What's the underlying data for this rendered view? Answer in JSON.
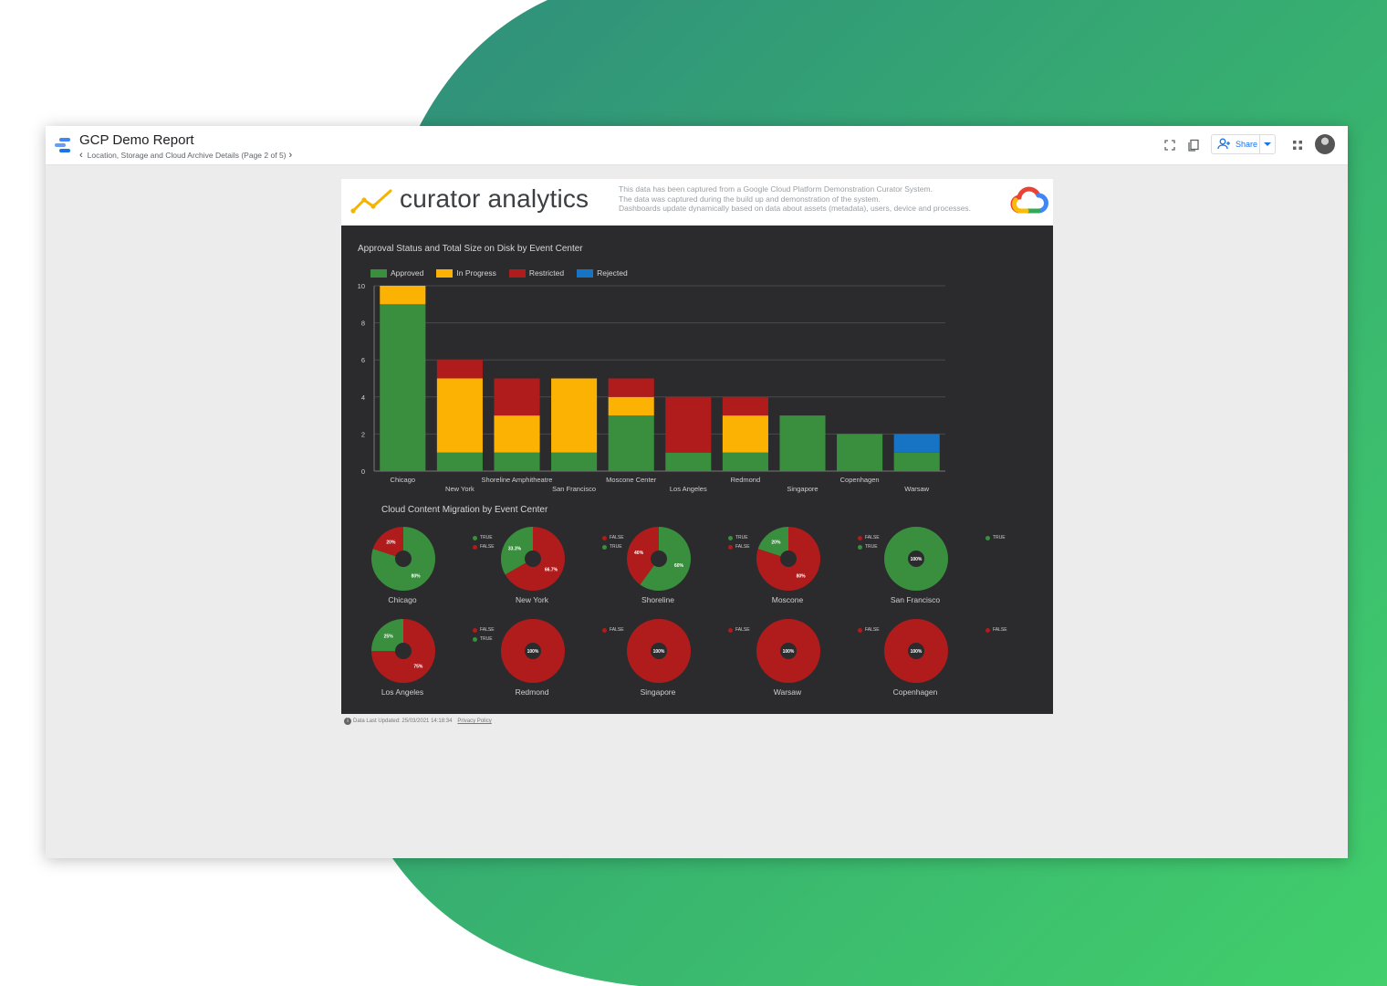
{
  "app": {
    "report_title": "GCP Demo Report",
    "page_label": "Location, Storage and Cloud Archive Details (Page 2 of 5)",
    "share_label": "Share"
  },
  "icons": {
    "prev_page": "chevron-left-icon",
    "next_page": "chevron-right-icon",
    "fullscreen": "fullscreen-icon",
    "copy": "copy-icon",
    "add_person": "add-person-icon",
    "dropdown": "chevron-down-icon",
    "apps": "apps-grid-icon",
    "avatar": "user-avatar"
  },
  "header": {
    "brand": "curator analytics",
    "desc_line1": "This data has been captured from a Google Cloud Platform Demonstration Curator System.",
    "desc_line2": "The data was captured during the build up and demonstration of the system.",
    "desc_line3": "Dashboards update dynamically based on data about assets (metadata), users, device and processes."
  },
  "colors": {
    "approved": "#3a8f3e",
    "in_progress": "#fbb203",
    "restricted": "#b01c1c",
    "rejected": "#1773c3",
    "true": "#3a8f3e",
    "false": "#b01c1c",
    "canvas_bg": "#2b2b2e",
    "gridline": "#4a4a4d"
  },
  "footer": {
    "updated": "Data Last Updated: 25/03/2021 14:18:34",
    "privacy": "Privacy Policy"
  },
  "chart_data": [
    {
      "type": "bar",
      "stacked": true,
      "title": "Approval Status and Total Size on Disk by Event Center",
      "legend_position": "top-left",
      "categories": [
        "Chicago",
        "New York",
        "Shoreline Amphitheatre",
        "San Francisco",
        "Moscone Center",
        "Los Angeles",
        "Redmond",
        "Singapore",
        "Copenhagen",
        "Warsaw"
      ],
      "series": [
        {
          "name": "Approved",
          "values": [
            9,
            1,
            1,
            1,
            3,
            1,
            1,
            3,
            2,
            1
          ]
        },
        {
          "name": "In Progress",
          "values": [
            1,
            4,
            2,
            4,
            1,
            0,
            2,
            0,
            0,
            0
          ]
        },
        {
          "name": "Restricted",
          "values": [
            0,
            1,
            2,
            0,
            1,
            3,
            1,
            0,
            0,
            0
          ]
        },
        {
          "name": "Rejected",
          "values": [
            0,
            0,
            0,
            0,
            0,
            0,
            0,
            0,
            0,
            1
          ]
        }
      ],
      "ylim": [
        0,
        10
      ],
      "yticks": [
        "0",
        "2",
        "4",
        "6",
        "8",
        "10"
      ],
      "grid": true
    },
    {
      "type": "pie",
      "title": "Cloud Content Migration by Event Center",
      "pies": [
        {
          "name": "Chicago",
          "slices": [
            {
              "label": "TRUE",
              "value": 80,
              "text": "80%"
            },
            {
              "label": "FALSE",
              "value": 20,
              "text": "20%"
            }
          ]
        },
        {
          "name": "New York",
          "slices": [
            {
              "label": "FALSE",
              "value": 66.7,
              "text": "66.7%"
            },
            {
              "label": "TRUE",
              "value": 33.3,
              "text": "33.3%"
            }
          ]
        },
        {
          "name": "Shoreline",
          "slices": [
            {
              "label": "TRUE",
              "value": 60,
              "text": "60%"
            },
            {
              "label": "FALSE",
              "value": 40,
              "text": "40%"
            }
          ]
        },
        {
          "name": "Moscone",
          "slices": [
            {
              "label": "FALSE",
              "value": 80,
              "text": "80%"
            },
            {
              "label": "TRUE",
              "value": 20,
              "text": "20%"
            }
          ]
        },
        {
          "name": "San Francisco",
          "slices": [
            {
              "label": "TRUE",
              "value": 100,
              "text": "100%"
            }
          ]
        },
        {
          "name": "Los Angeles",
          "slices": [
            {
              "label": "FALSE",
              "value": 75,
              "text": "75%"
            },
            {
              "label": "TRUE",
              "value": 25,
              "text": "25%"
            }
          ]
        },
        {
          "name": "Redmond",
          "slices": [
            {
              "label": "FALSE",
              "value": 100,
              "text": "100%"
            }
          ]
        },
        {
          "name": "Singapore",
          "slices": [
            {
              "label": "FALSE",
              "value": 100,
              "text": "100%"
            }
          ]
        },
        {
          "name": "Warsaw",
          "slices": [
            {
              "label": "FALSE",
              "value": 100,
              "text": "100%"
            }
          ]
        },
        {
          "name": "Copenhagen",
          "slices": [
            {
              "label": "FALSE",
              "value": 100,
              "text": "100%"
            }
          ]
        }
      ]
    }
  ]
}
